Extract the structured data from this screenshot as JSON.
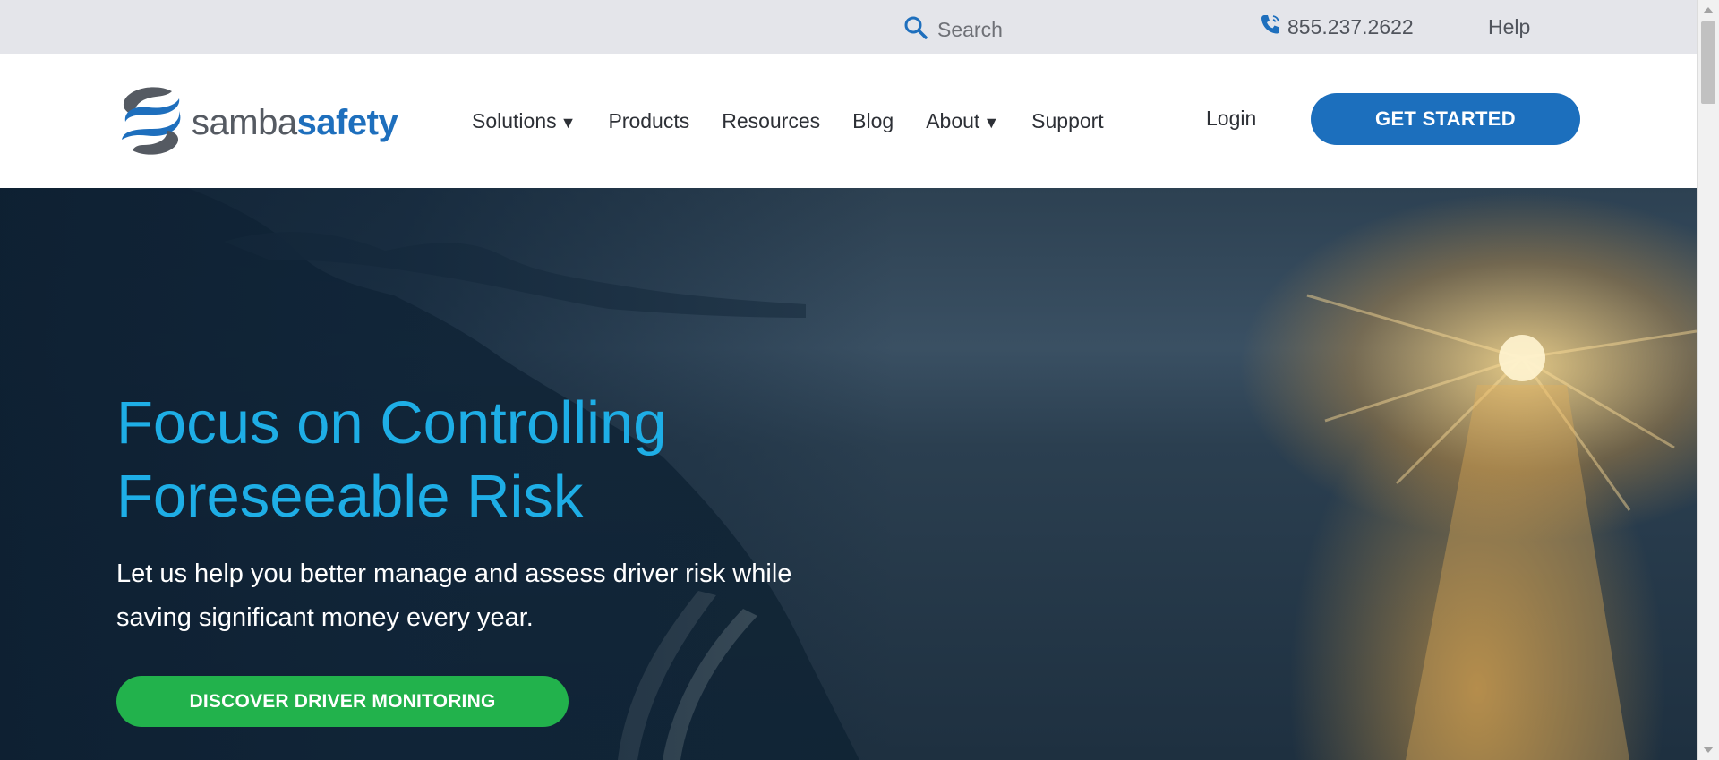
{
  "utility": {
    "search_placeholder": "Search",
    "phone": "855.237.2622",
    "help": "Help"
  },
  "brand": {
    "name_a": "samba",
    "name_b": "safety",
    "accent_color": "#1e6fbd"
  },
  "nav": {
    "items": [
      {
        "label": "Solutions",
        "has_dropdown": true
      },
      {
        "label": "Products",
        "has_dropdown": false
      },
      {
        "label": "Resources",
        "has_dropdown": false
      },
      {
        "label": "Blog",
        "has_dropdown": false
      },
      {
        "label": "About",
        "has_dropdown": true
      },
      {
        "label": "Support",
        "has_dropdown": false
      }
    ],
    "caret": "▼",
    "login": "Login",
    "cta": "GET STARTED"
  },
  "hero": {
    "title_line1": "Focus on Controlling",
    "title_line2": "Foreseeable Risk",
    "subtitle": "Let us help you better manage and assess driver risk while saving significant money every year.",
    "button": "DISCOVER DRIVER MONITORING",
    "title_color": "#1eaee6",
    "button_color": "#22b24c"
  },
  "icons": {
    "search": "search-icon",
    "phone": "phone-icon",
    "logo": "samba-s-logo-icon"
  }
}
